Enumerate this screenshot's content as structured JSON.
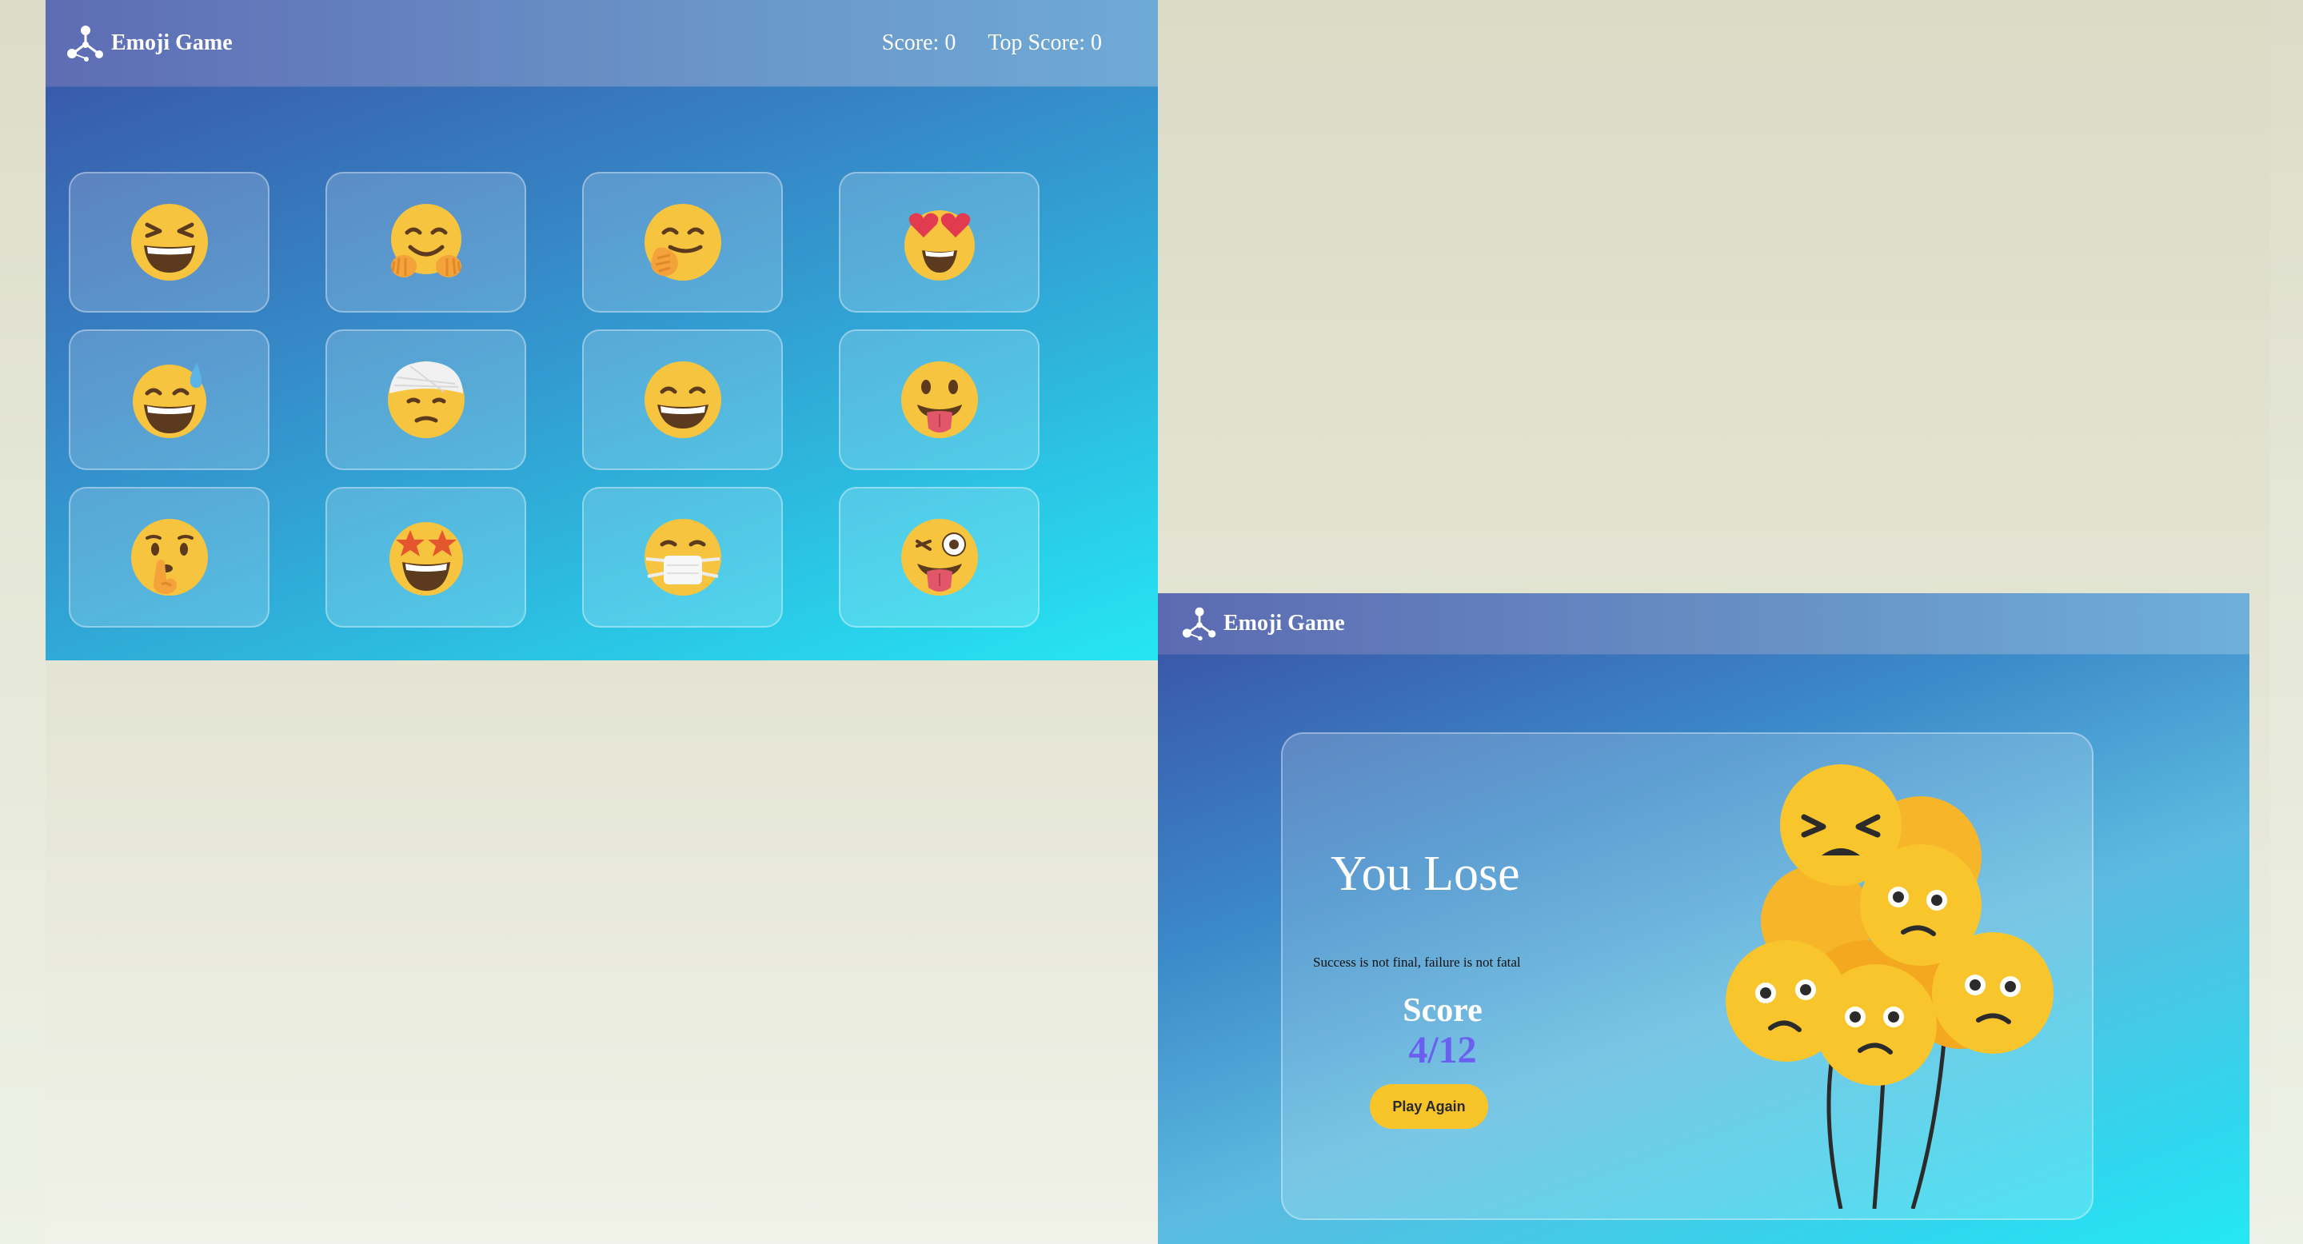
{
  "game_screen": {
    "navbar": {
      "title": "Emoji Game",
      "score_text": "Score: 0",
      "top_score_text": "Top Score: 0",
      "logo_icon": "network-logo-icon"
    },
    "emoji_cards": [
      {
        "name": "grinning-squinting-face-icon"
      },
      {
        "name": "hugging-face-icon"
      },
      {
        "name": "face-with-hand-over-mouth-icon"
      },
      {
        "name": "heart-eyes-face-icon"
      },
      {
        "name": "grinning-face-with-sweat-icon"
      },
      {
        "name": "face-with-head-bandage-icon"
      },
      {
        "name": "grinning-face-with-smiling-eyes-icon"
      },
      {
        "name": "face-with-tongue-icon"
      },
      {
        "name": "shushing-face-icon"
      },
      {
        "name": "star-struck-face-icon"
      },
      {
        "name": "face-with-medical-mask-icon"
      },
      {
        "name": "winking-face-with-tongue-icon"
      }
    ]
  },
  "result_screen": {
    "navbar": {
      "title": "Emoji Game",
      "logo_icon": "network-logo-icon"
    },
    "heading": "You Lose",
    "quote": "Success is not final, failure is not fatal",
    "score_label": "Score",
    "score_value": "4/12",
    "play_again_label": "Play Again",
    "illustration": "sad-emoji-balloons-icon"
  },
  "colors": {
    "accent_score": "#6a5ff0",
    "button": "#f7c52a",
    "emoji_yellow": "#f6c43e"
  }
}
